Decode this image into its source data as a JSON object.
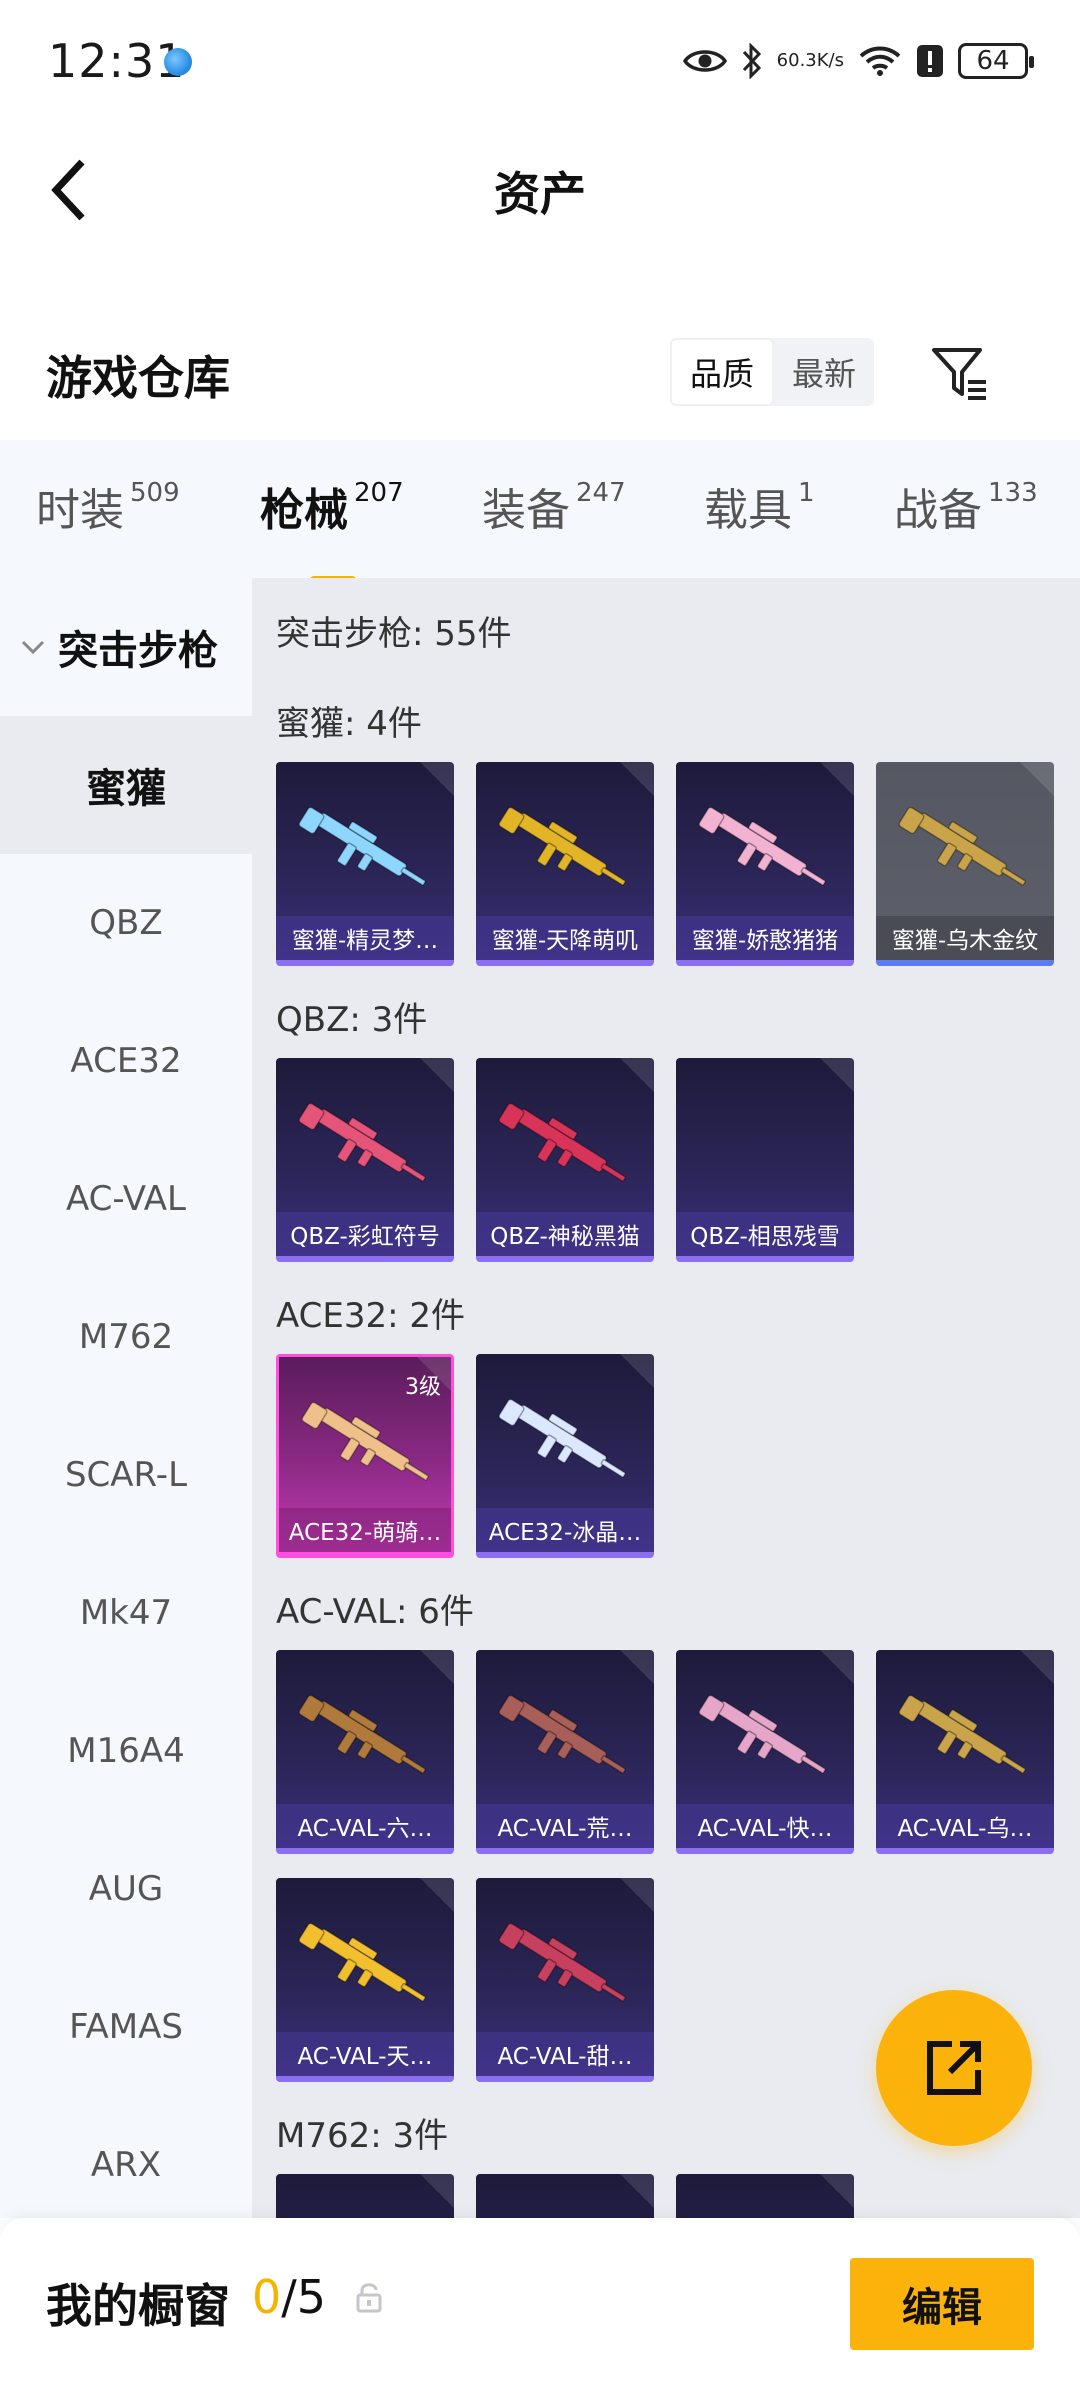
{
  "status_bar": {
    "time": "12:31",
    "speed_top": "60.3",
    "speed_bottom": "K/s",
    "battery": "64"
  },
  "nav": {
    "title": "资产",
    "back_icon": "chevron-left-icon"
  },
  "warehouse": {
    "title": "游戏仓库",
    "sort_options": [
      "品质",
      "最新"
    ],
    "sort_active": "品质",
    "filter_icon": "filter-icon"
  },
  "category_tabs": [
    {
      "label": "时装",
      "count": "509"
    },
    {
      "label": "枪械",
      "count": "207",
      "active": true
    },
    {
      "label": "装备",
      "count": "247"
    },
    {
      "label": "载具",
      "count": "1"
    },
    {
      "label": "战备",
      "count": "133"
    }
  ],
  "side_nav": {
    "group": "突击步枪",
    "items": [
      "蜜獾",
      "QBZ",
      "ACE32",
      "AC-VAL",
      "M762",
      "SCAR-L",
      "Mk47",
      "M16A4",
      "AUG",
      "FAMAS",
      "ARX"
    ],
    "active": "蜜獾"
  },
  "content": {
    "summary": "突击步枪: 55件",
    "sections": [
      {
        "title": "蜜獾: 4件",
        "cards": [
          {
            "name": "蜜獾-精灵梦…",
            "gun_color": "#8fd6ff"
          },
          {
            "name": "蜜獾-天降萌叽",
            "gun_color": "#e2b428"
          },
          {
            "name": "蜜獾-娇憨猪猪",
            "gun_color": "#f2b3d3"
          },
          {
            "name": "蜜獾-乌木金纹",
            "gun_color": "#c9a44a"
          }
        ]
      },
      {
        "title": "QBZ: 3件",
        "cards": [
          {
            "name": "QBZ-彩虹符号",
            "gun_color": "#e5557a"
          },
          {
            "name": "QBZ-神秘黑猫",
            "gun_color": "#d8345a"
          },
          {
            "name": "QBZ-相思残雪",
            "gun_color": ""
          }
        ]
      },
      {
        "title": "ACE32: 2件",
        "cards": [
          {
            "name": "ACE32-萌骑…",
            "gun_color": "#f0c08a",
            "level": "3级"
          },
          {
            "name": "ACE32-冰晶…",
            "gun_color": "#dbe8ff"
          }
        ]
      },
      {
        "title": "AC-VAL: 6件",
        "cards": [
          {
            "name": "AC-VAL-六…",
            "gun_color": "#b07a3c"
          },
          {
            "name": "AC-VAL-荒…",
            "gun_color": "#a85f5a"
          },
          {
            "name": "AC-VAL-快…",
            "gun_color": "#e6a6c9"
          },
          {
            "name": "AC-VAL-乌…",
            "gun_color": "#c9a44a"
          },
          {
            "name": "AC-VAL-天…",
            "gun_color": "#f2bf2e"
          },
          {
            "name": "AC-VAL-甜…",
            "gun_color": "#c8405f"
          }
        ]
      },
      {
        "title": "M762: 3件",
        "cards": [
          {
            "name": "",
            "gun_color": "#e2b428"
          },
          {
            "name": "",
            "gun_color": "#dddddd"
          },
          {
            "name": "",
            "gun_color": "#c96a3a"
          }
        ]
      }
    ]
  },
  "fab": {
    "icon": "share-external-icon"
  },
  "bottom_bar": {
    "label": "我的橱窗",
    "count_current": "0",
    "count_total": "/5",
    "edit_label": "编辑"
  },
  "colors": {
    "accent": "#fbb20a",
    "card_purple": "#2b2556",
    "card_pink": "#c53bb5"
  }
}
